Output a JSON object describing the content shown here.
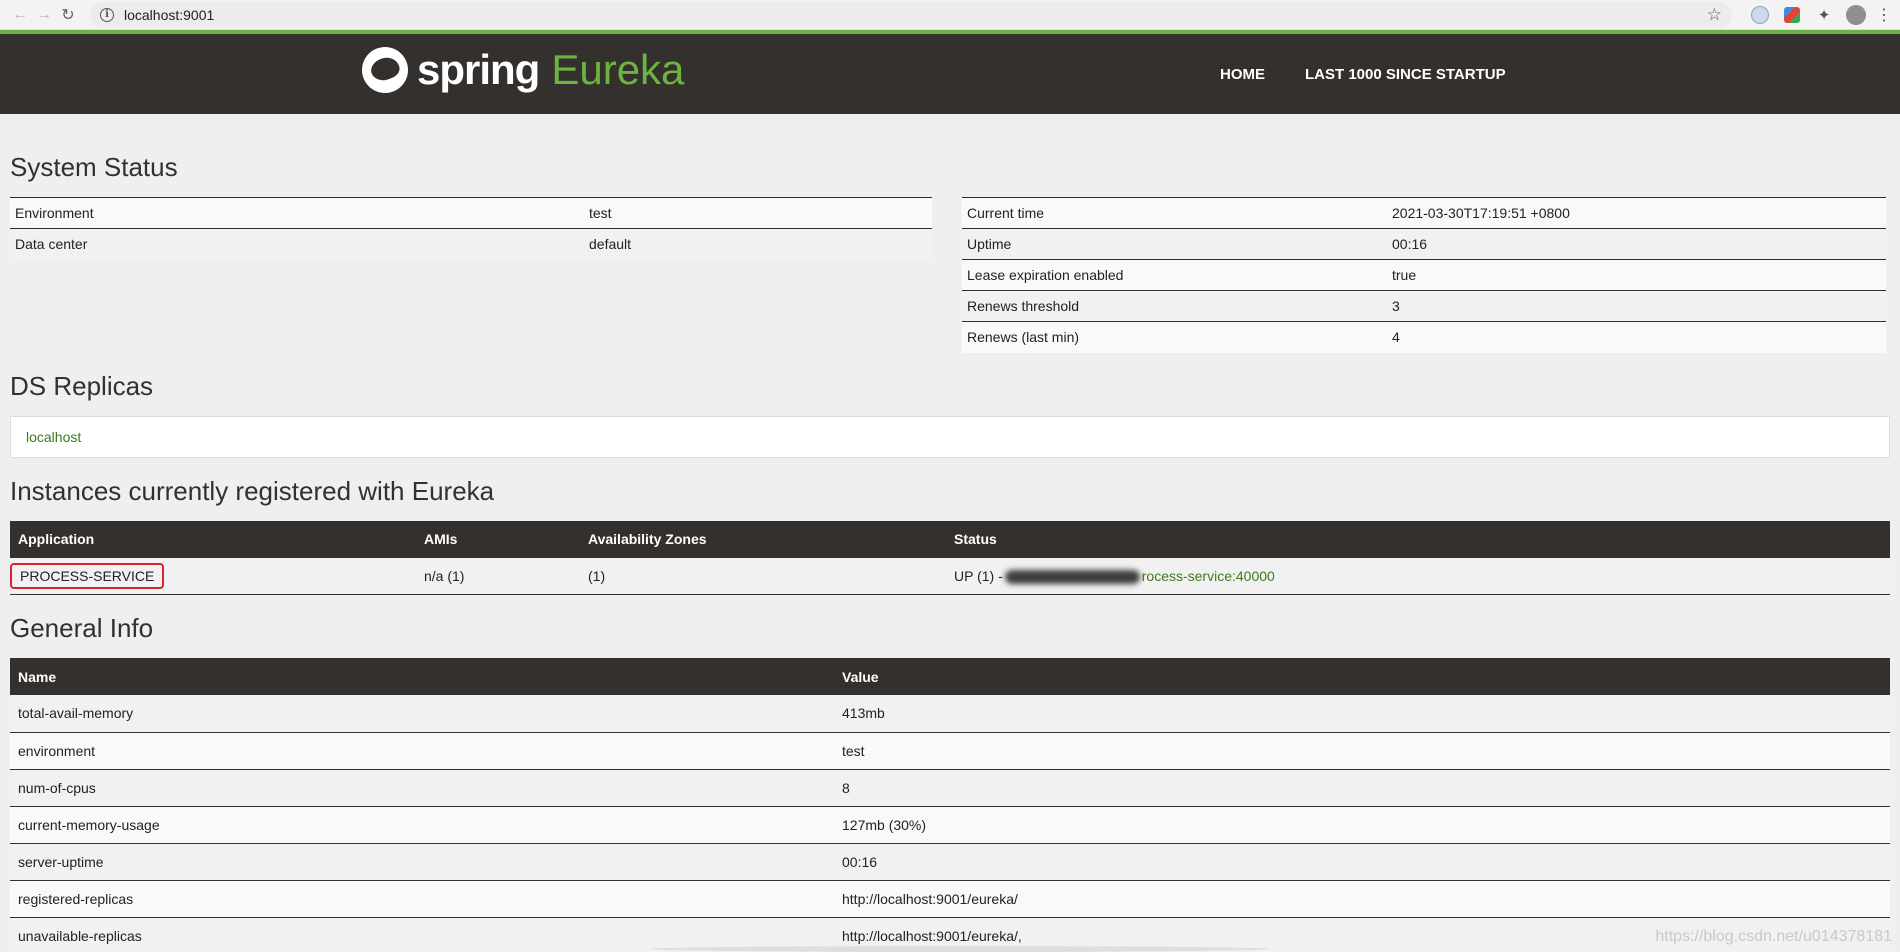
{
  "browser": {
    "url": "localhost:9001"
  },
  "header": {
    "logo_spring": "spring",
    "logo_eureka": "Eureka",
    "nav": [
      "HOME",
      "LAST 1000 SINCE STARTUP"
    ]
  },
  "system_status": {
    "title": "System Status",
    "left": [
      {
        "key": "Environment",
        "value": "test"
      },
      {
        "key": "Data center",
        "value": "default"
      }
    ],
    "right": [
      {
        "key": "Current time",
        "value": "2021-03-30T17:19:51 +0800"
      },
      {
        "key": "Uptime",
        "value": "00:16"
      },
      {
        "key": "Lease expiration enabled",
        "value": "true"
      },
      {
        "key": "Renews threshold",
        "value": "3"
      },
      {
        "key": "Renews (last min)",
        "value": "4"
      }
    ]
  },
  "ds_replicas": {
    "title": "DS Replicas",
    "items": [
      "localhost"
    ]
  },
  "instances": {
    "title": "Instances currently registered with Eureka",
    "headers": [
      "Application",
      "AMIs",
      "Availability Zones",
      "Status"
    ],
    "rows": [
      {
        "application": "PROCESS-SERVICE",
        "amis": "n/a (1)",
        "zones": "(1)",
        "status": "UP (1) -",
        "status_link": "rocess-service:40000"
      }
    ]
  },
  "general_info": {
    "title": "General Info",
    "headers": [
      "Name",
      "Value"
    ],
    "rows": [
      {
        "name": "total-avail-memory",
        "value": "413mb"
      },
      {
        "name": "environment",
        "value": "test"
      },
      {
        "name": "num-of-cpus",
        "value": "8"
      },
      {
        "name": "current-memory-usage",
        "value": "127mb (30%)"
      },
      {
        "name": "server-uptime",
        "value": "00:16"
      },
      {
        "name": "registered-replicas",
        "value": "http://localhost:9001/eureka/"
      },
      {
        "name": "unavailable-replicas",
        "value": "http://localhost:9001/eureka/,"
      }
    ]
  },
  "watermark": "https://blog.csdn.net/u014378181"
}
